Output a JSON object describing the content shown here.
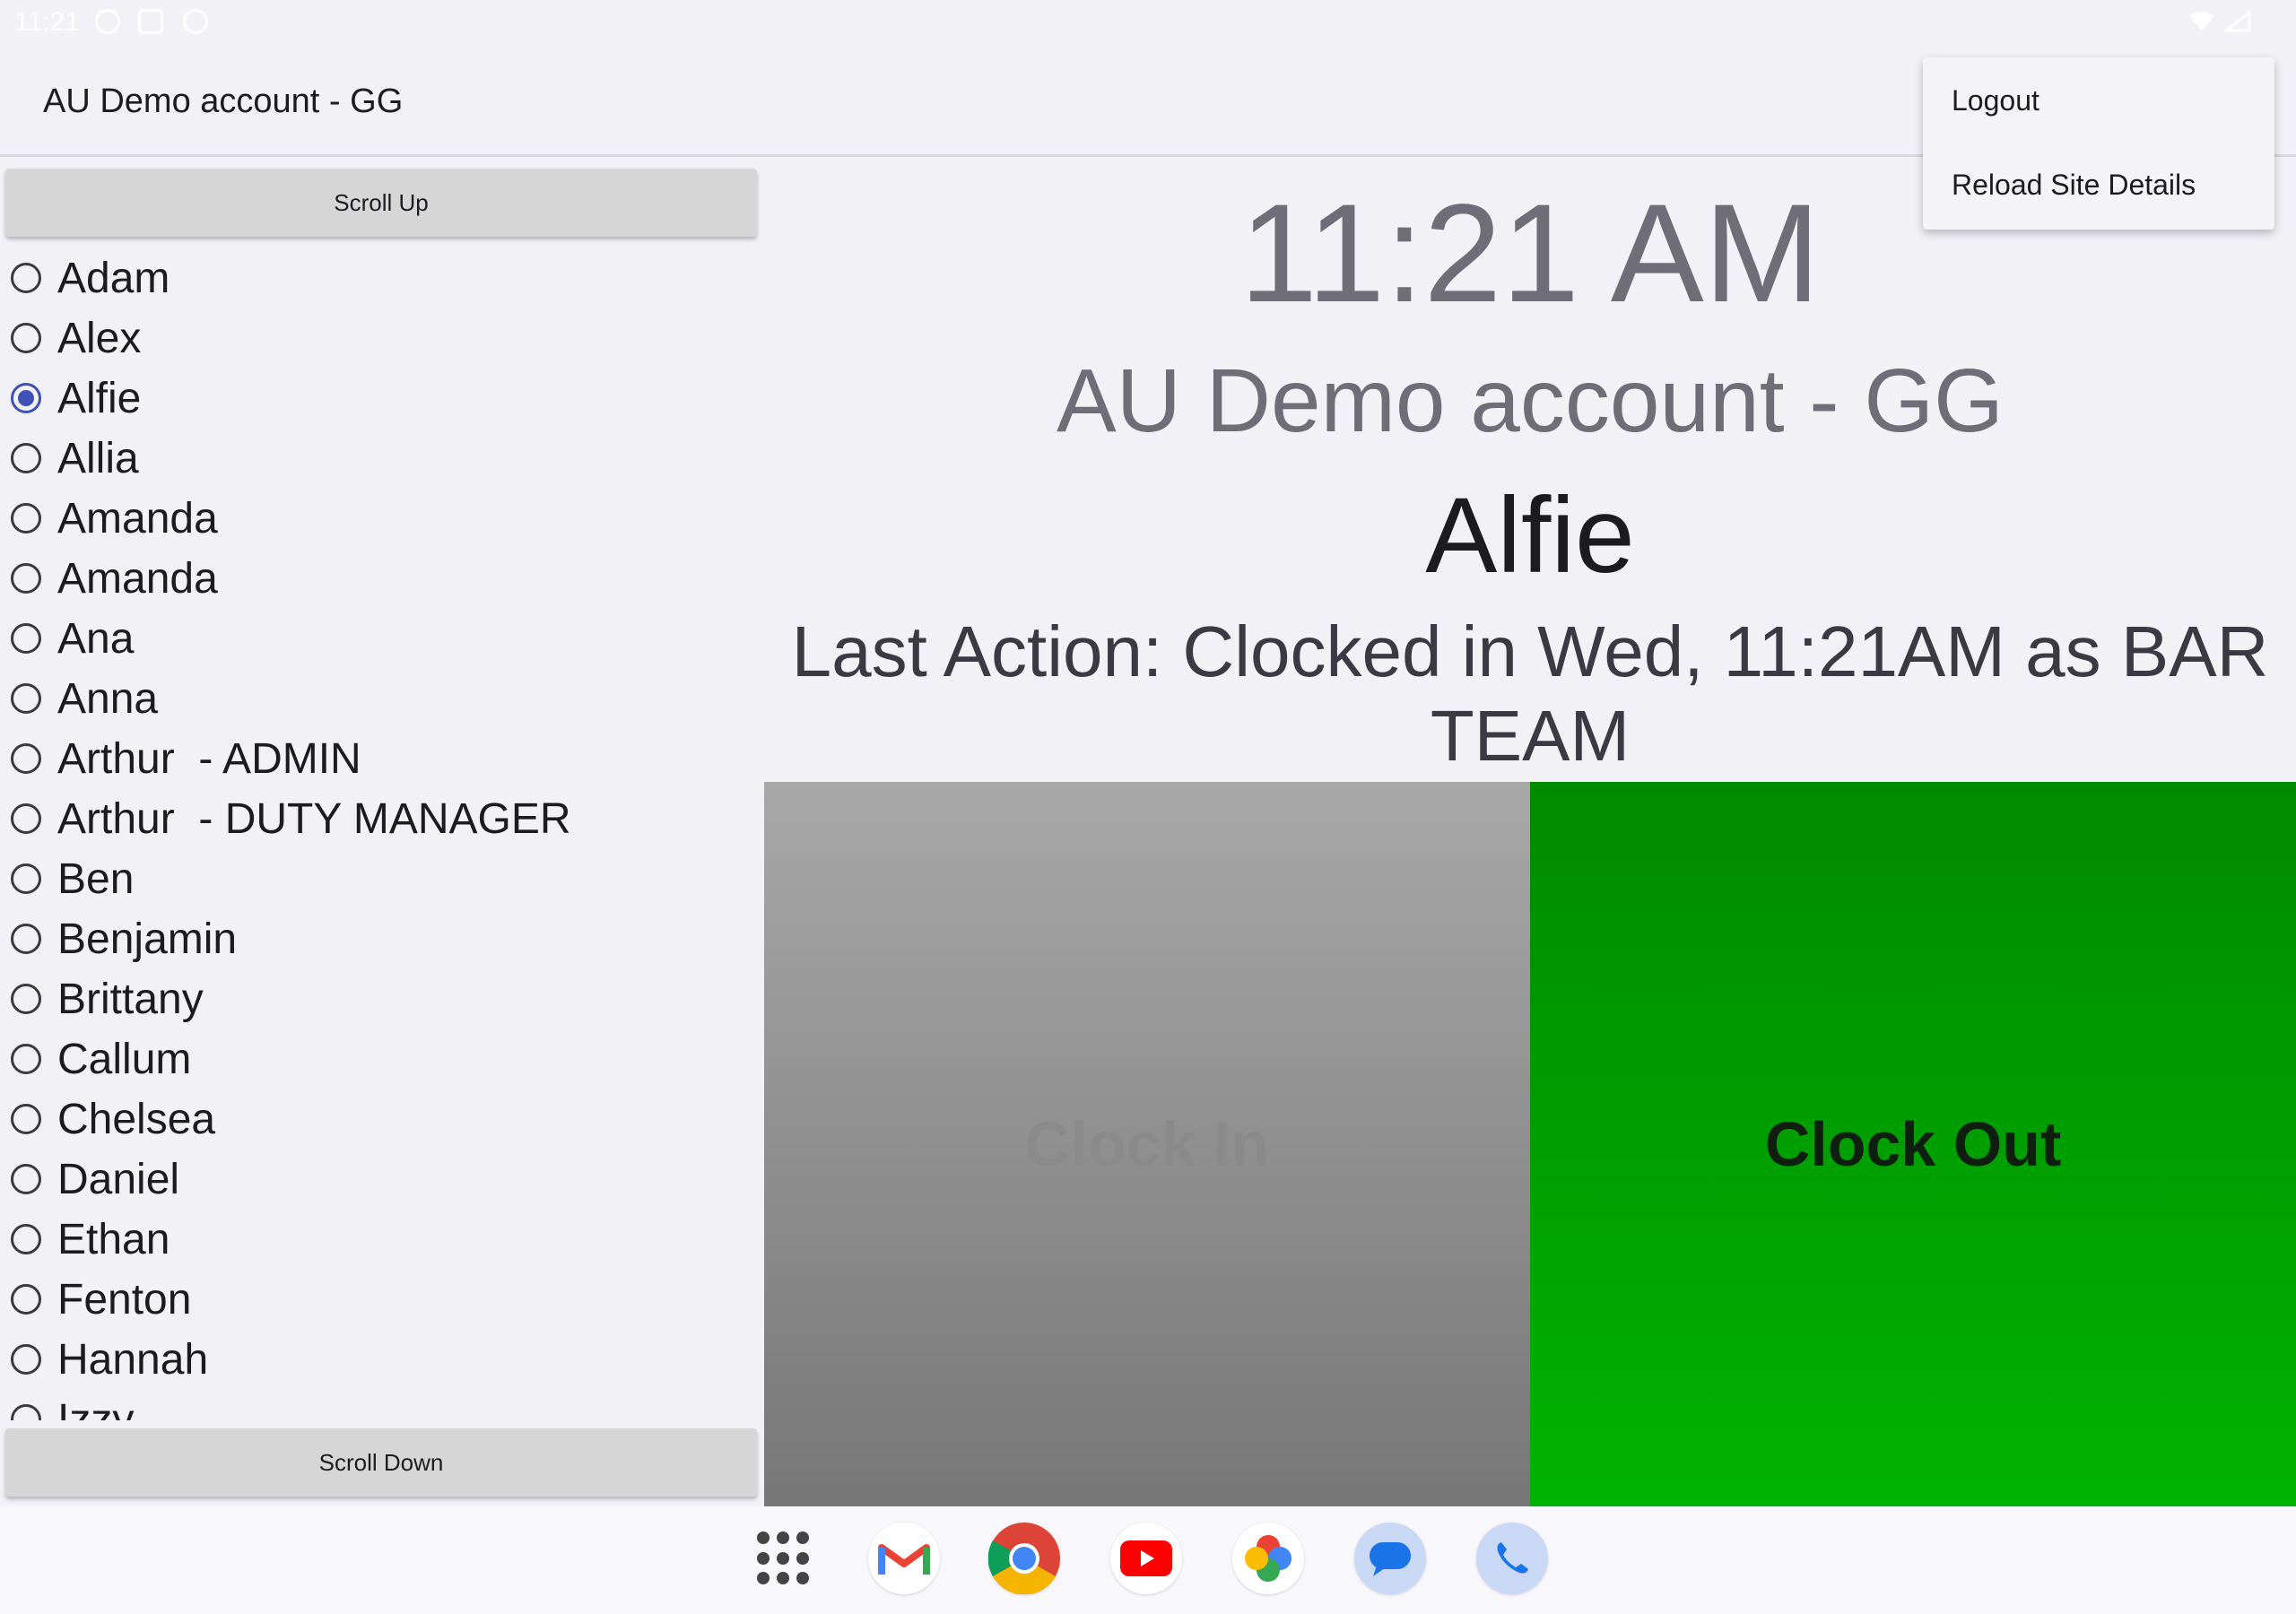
{
  "status_bar": {
    "time": "11:21"
  },
  "app_bar": {
    "title": "AU Demo account - GG"
  },
  "list": {
    "scroll_up_label": "Scroll Up",
    "scroll_down_label": "Scroll Down",
    "selected": "Alfie",
    "employees": [
      "Adam",
      "Alex",
      "Alfie",
      "Allia",
      "Amanda",
      "Amanda",
      "Ana",
      "Anna",
      "Arthur  - ADMIN",
      "Arthur  - DUTY MANAGER",
      "Ben",
      "Benjamin",
      "Brittany",
      "Callum",
      "Chelsea",
      "Daniel",
      "Ethan",
      "Fenton",
      "Hannah",
      "Izzy"
    ]
  },
  "main": {
    "time": "11:21 AM",
    "site_name": "AU Demo account - GG",
    "employee_name": "Alfie",
    "last_action": "Last Action: Clocked in Wed, 11:21AM as BAR TEAM",
    "clock_in_label": "Clock In",
    "clock_out_label": "Clock Out"
  },
  "menu": {
    "logout": "Logout",
    "reload": "Reload Site Details"
  },
  "taskbar": {
    "icons": [
      "apps-grid-icon",
      "gmail-icon",
      "chrome-icon",
      "youtube-icon",
      "photos-icon",
      "messages-icon",
      "phone-icon"
    ]
  },
  "colors": {
    "accent": "#3f51b5",
    "clock_out_green": "#00a000",
    "clock_in_grey": "#8f8f8f"
  }
}
